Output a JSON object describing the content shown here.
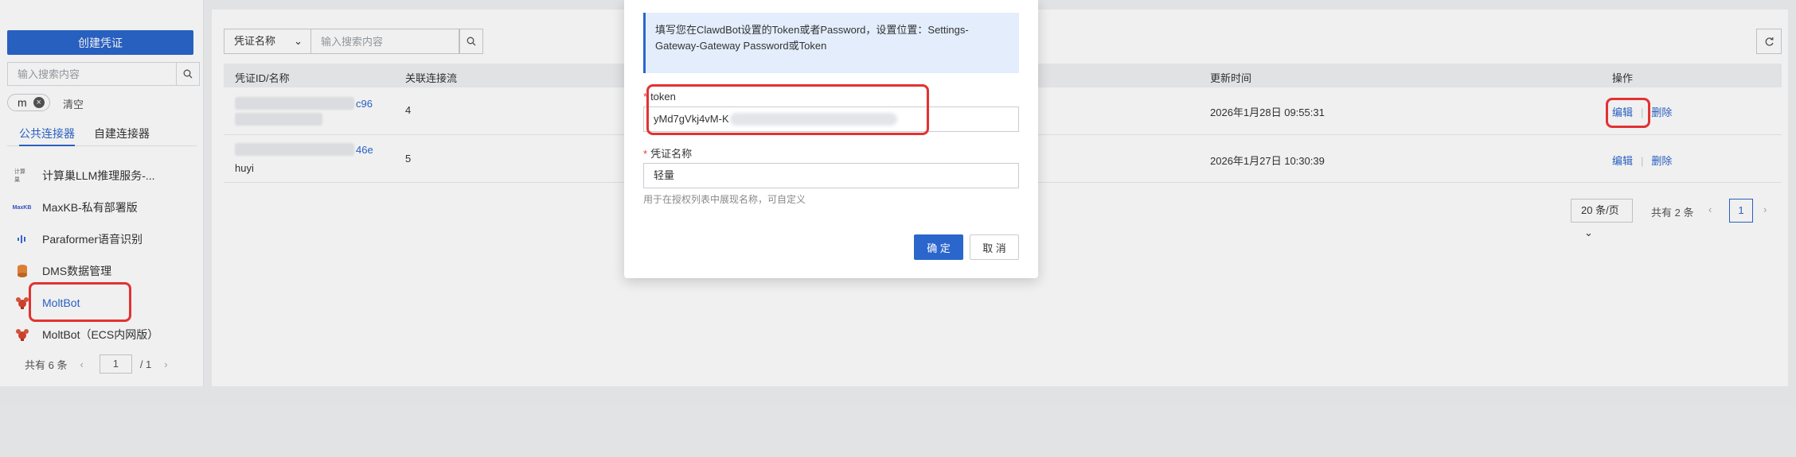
{
  "sidebar": {
    "create_button": "创建凭证",
    "search_placeholder": "输入搜索内容",
    "filter_tag": "m",
    "clear_label": "清空",
    "tabs": [
      {
        "label": "公共连接器",
        "active": true
      },
      {
        "label": "自建连接器",
        "active": false
      }
    ],
    "connectors": [
      {
        "label": "计算巢LLM推理服务-...",
        "icon": "computenest-logo",
        "icon_text": "计算巢"
      },
      {
        "label": "MaxKB-私有部署版",
        "icon": "maxkb-logo",
        "icon_text": "MaxKB"
      },
      {
        "label": "Paraformer语音识别",
        "icon": "paraformer-logo",
        "icon_text": ""
      },
      {
        "label": "DMS数据管理",
        "icon": "dms-logo",
        "icon_text": ""
      },
      {
        "label": "MoltBot",
        "icon": "lobster-logo",
        "icon_text": "",
        "selected": true
      },
      {
        "label": "MoltBot（ECS内网版）",
        "icon": "lobster-logo",
        "icon_text": ""
      }
    ],
    "pager": {
      "total": "共有 6 条",
      "page": "1",
      "pages": "/  1"
    }
  },
  "main": {
    "filter_select": "凭证名称",
    "search_placeholder": "输入搜索内容",
    "table": {
      "headers": [
        "凭证ID/名称",
        "关联连接流",
        "更新时间",
        "操作"
      ],
      "rows": [
        {
          "id_suffix": "c96",
          "name": "",
          "flows": "4",
          "updated": "2026年1月28日 09:55:31",
          "edit": "编辑",
          "delete": "删除"
        },
        {
          "id_suffix": "46e",
          "name": "huyi",
          "flows": "5",
          "updated": "2026年1月27日 10:30:39",
          "edit": "编辑",
          "delete": "删除"
        }
      ]
    },
    "pager": {
      "page_size": "20 条/页",
      "total": "共有 2 条",
      "current": "1"
    }
  },
  "modal": {
    "info": "填写您在ClawdBot设置的Token或者Password，设置位置：Settings-Gateway-Gateway Password或Token",
    "token_label": "token",
    "token_value": "yMd7gVkj4vM-K",
    "name_label": "凭证名称",
    "name_value": "轻量",
    "hint": "用于在授权列表中展现名称，可自定义",
    "ok_label": "确 定",
    "cancel_label": "取 消"
  },
  "colors": {
    "accent": "#2b66cc",
    "highlight": "#e23232",
    "info_bg": "#e3edfc"
  }
}
